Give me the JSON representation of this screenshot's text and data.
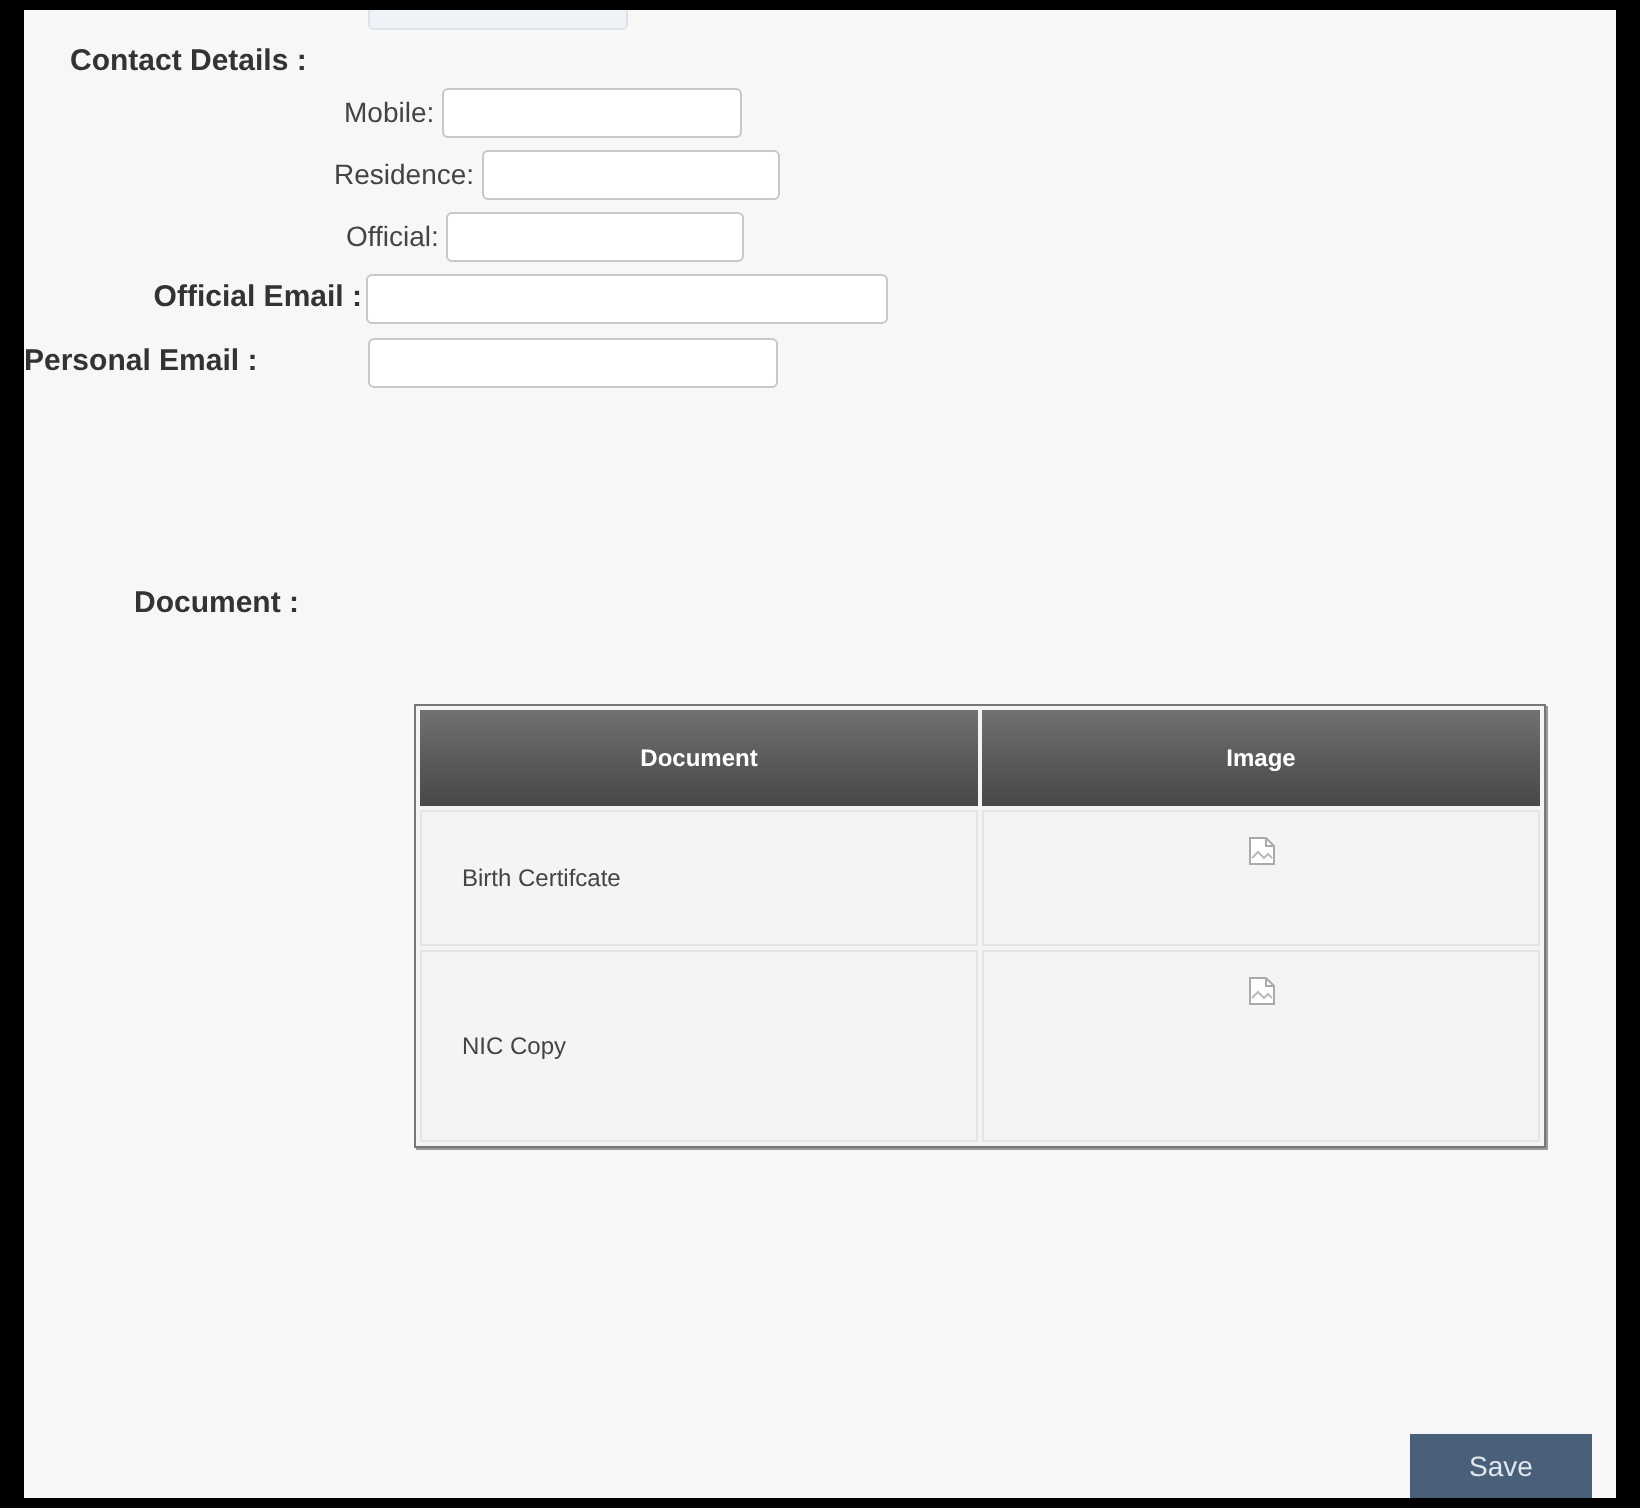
{
  "contact_details": {
    "label": "Contact Details :",
    "phones": [
      {
        "label": "Mobile:"
      },
      {
        "label": "Residence:"
      },
      {
        "label": "Official:"
      }
    ]
  },
  "official_email": {
    "label": "Official Email :"
  },
  "personal_email": {
    "label": "Personal Email :"
  },
  "document": {
    "label": "Document :"
  },
  "table": {
    "columns": [
      "Document",
      "Image"
    ],
    "rows": [
      {
        "document": "Birth Certifcate"
      },
      {
        "document": "NIC Copy"
      }
    ]
  },
  "save_button": "Save"
}
